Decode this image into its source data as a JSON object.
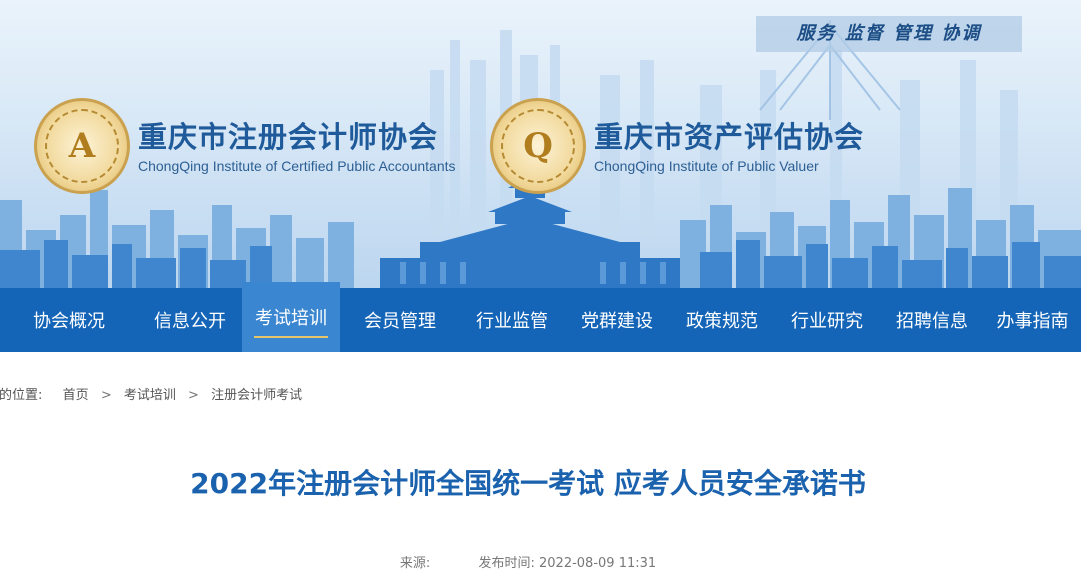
{
  "header": {
    "motto": "服务 监督 管理 协调",
    "orgs": [
      {
        "cn": "重庆市注册会计师协会",
        "en": "ChongQing Institute of Certified Public Accountants",
        "seal_icon": "cicpa-seal-icon"
      },
      {
        "cn": "重庆市资产评估协会",
        "en": "ChongQing Institute of Public Valuer",
        "seal_icon": "valuer-seal-icon"
      }
    ]
  },
  "nav": {
    "items": [
      {
        "label": "协会概况"
      },
      {
        "label": "信息公开"
      },
      {
        "label": "考试培训",
        "active": true
      },
      {
        "label": "会员管理"
      },
      {
        "label": "行业监管"
      },
      {
        "label": "党群建设"
      },
      {
        "label": "政策规范"
      },
      {
        "label": "行业研究"
      },
      {
        "label": "招聘信息"
      },
      {
        "label": "办事指南"
      }
    ]
  },
  "breadcrumb": {
    "prefix": "您的位置:",
    "items": [
      "首页",
      "考试培训",
      "注册会计师考试"
    ],
    "separator": ">"
  },
  "article": {
    "title": "2022年注册会计师全国统一考试 应考人员安全承诺书",
    "source_label": "来源:",
    "source_value": "",
    "published_label": "发布时间:",
    "published_value": "2022-08-09 11:31"
  },
  "colors": {
    "nav_bg": "#1465b7",
    "nav_active": "#3a86d1",
    "title": "#1a62ad",
    "accent_gold": "#e6c56a"
  }
}
